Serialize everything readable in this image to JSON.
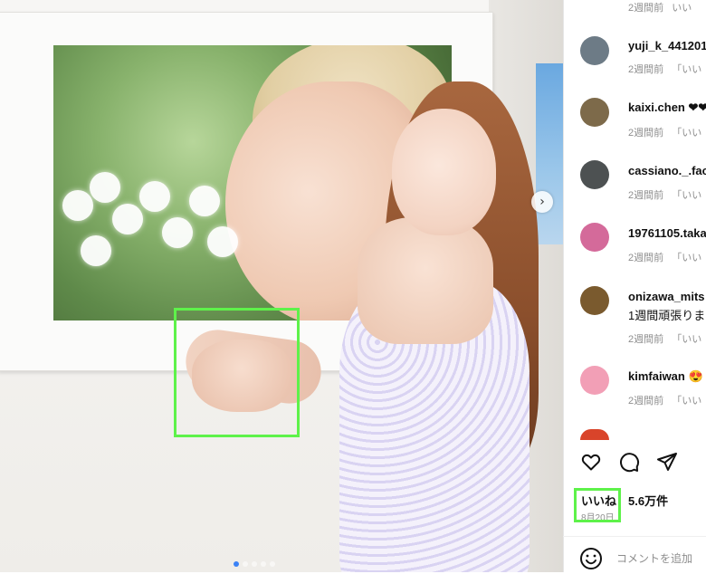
{
  "post": {
    "likes_text": "いいね！5.6万件",
    "date_text": "8月20日",
    "comment_placeholder": "コメントを追加"
  },
  "comments": [
    {
      "username": "",
      "time": "2週間前",
      "reply": "いい",
      "avatar_color": "#c9b89c"
    },
    {
      "username": "yuji_k_441201",
      "time": "2週間前",
      "reply": "「いい",
      "avatar_color": "#6d7b86"
    },
    {
      "username": "kaixi.chen ❤❤",
      "time": "2週間前",
      "reply": "「いい",
      "avatar_color": "#7d6a4a"
    },
    {
      "username": "cassiano._.fac",
      "time": "2週間前",
      "reply": "「いい",
      "avatar_color": "#4d5152"
    },
    {
      "username": "19761105.taka",
      "time": "2週間前",
      "reply": "「いい",
      "avatar_color": "#d46a9a"
    },
    {
      "username": "onizawa_mits",
      "text": "1週間頑張りま",
      "time": "2週間前",
      "reply": "「いい",
      "avatar_color": "#7a5a2e"
    },
    {
      "username": "kimfaiwan 😍",
      "time": "2週間前",
      "reply": "「いい",
      "avatar_color": "#f29fb6"
    }
  ],
  "icons": {
    "like": "heart-icon",
    "comment": "comment-icon",
    "share": "send-icon",
    "next": "chevron-right-icon",
    "emoji": "smile-icon"
  },
  "colors": {
    "highlight": "#5ef24a",
    "meta": "#8e8e8e"
  }
}
